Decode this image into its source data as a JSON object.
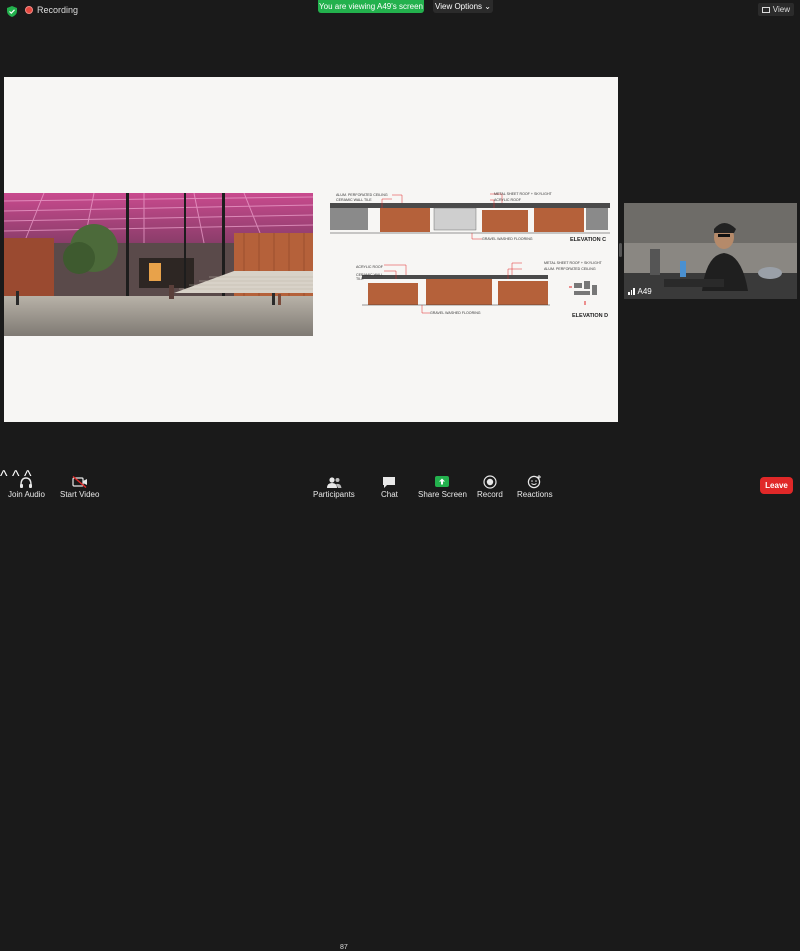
{
  "topbar": {
    "recording_label": "Recording",
    "viewing_banner": "You are viewing A49's screen",
    "view_options_label": "View Options",
    "view_button_label": "View"
  },
  "slide": {
    "elevation_c": {
      "title": "ELEVATION C",
      "labels": [
        "ALUM. PERFORATED CEILING",
        "CERAMIC WALL TILE",
        "METAL SHEET ROOF + SKYLIGHT",
        "ACRYLIC ROOF",
        "GRAVEL WASHED FLOORING"
      ]
    },
    "elevation_d": {
      "title": "ELEVATION D",
      "labels": [
        "ACRYLIC ROOF",
        "CERAMIC WALL TILE",
        "METAL SHEET ROOF + SKYLIGHT",
        "ALUM. PERFORATED CEILING",
        "GRAVEL WASHED FLOORING"
      ]
    }
  },
  "participant": {
    "name": "A49"
  },
  "toolbar": {
    "join_audio": "Join Audio",
    "start_video": "Start Video",
    "participants": "Participants",
    "participants_count": "87",
    "chat": "Chat",
    "share_screen": "Share Screen",
    "record": "Record",
    "reactions": "Reactions",
    "leave": "Leave"
  },
  "colors": {
    "banner_green": "#23b14d",
    "leave_red": "#e02828",
    "brick": "#b5613a"
  }
}
